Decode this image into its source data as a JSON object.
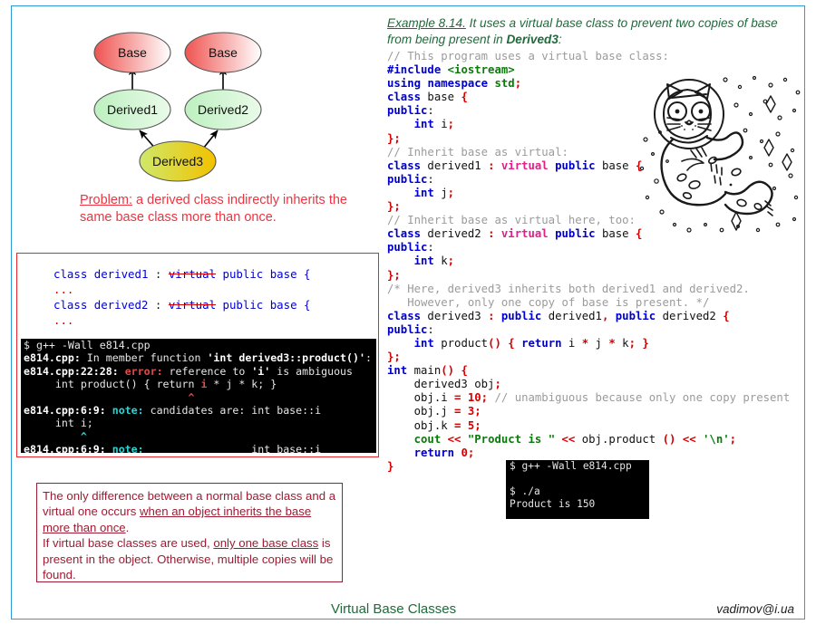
{
  "frame": {
    "border_color": "#2e9bd6"
  },
  "diagram": {
    "title": "virtual-base-class-inheritance-diagram",
    "nodes": [
      {
        "id": "base-left",
        "label": "Base",
        "fill_from": "#ef5350",
        "fill_to": "#ffffff"
      },
      {
        "id": "base-right",
        "label": "Base",
        "fill_from": "#ef5350",
        "fill_to": "#ffffff"
      },
      {
        "id": "derived1",
        "label": "Derived1",
        "fill_from": "#bdf0c0",
        "fill_to": "#e9fbe9"
      },
      {
        "id": "derived2",
        "label": "Derived2",
        "fill_from": "#bdf0c0",
        "fill_to": "#e9fbe9"
      },
      {
        "id": "derived3",
        "label": "Derived3",
        "fill_from": "#c9e56b",
        "fill_to": "#f0c400"
      }
    ],
    "edges": [
      {
        "from": "derived1",
        "to": "base-left"
      },
      {
        "from": "derived2",
        "to": "base-right"
      },
      {
        "from": "derived3",
        "to": "derived1"
      },
      {
        "from": "derived3",
        "to": "derived2"
      }
    ]
  },
  "problem": {
    "color": "#ef3340",
    "label": "Problem:",
    "text": " a derived class indirectly inherits the same base class more than once."
  },
  "snippet": {
    "border_color": "#e8252a",
    "lines": [
      [
        {
          "t": "class derived1 ",
          "c": "blue"
        },
        {
          "t": ": ",
          "c": "dark"
        },
        {
          "t": "virtual",
          "c": "strike"
        },
        {
          "t": " public base {",
          "c": "blue"
        }
      ],
      [
        {
          "t": "...",
          "c": "red"
        }
      ],
      [
        {
          "t": "class derived2 ",
          "c": "blue"
        },
        {
          "t": ": ",
          "c": "dark"
        },
        {
          "t": "virtual",
          "c": "strike"
        },
        {
          "t": " public base {",
          "c": "blue"
        }
      ],
      [
        {
          "t": "...",
          "c": "red"
        }
      ]
    ]
  },
  "terminal_left": {
    "background": "#000000",
    "lines": [
      [
        {
          "t": "$ ",
          "c": "white"
        },
        {
          "t": "g++ -Wall e814.cpp",
          "c": "white"
        }
      ],
      [
        {
          "t": "e814.cpp:",
          "c": "bold"
        },
        {
          "t": " In member function ",
          "c": "white"
        },
        {
          "t": "'int derived3::product()'",
          "c": "bold"
        },
        {
          "t": ":",
          "c": "white"
        }
      ],
      [
        {
          "t": "e814.cpp:22:28:",
          "c": "bold"
        },
        {
          "t": " ",
          "c": "white"
        },
        {
          "t": "error:",
          "c": "red"
        },
        {
          "t": " reference to ",
          "c": "white"
        },
        {
          "t": "'i'",
          "c": "bold"
        },
        {
          "t": " is ambiguous",
          "c": "white"
        }
      ],
      [
        {
          "t": "     int product() { return ",
          "c": "white"
        },
        {
          "t": "i",
          "c": "red"
        },
        {
          "t": " * j * k; }",
          "c": "white"
        }
      ],
      [
        {
          "t": "                          ",
          "c": "white"
        },
        {
          "t": "^",
          "c": "caretred"
        }
      ],
      [
        {
          "t": "e814.cpp:6:9:",
          "c": "bold"
        },
        {
          "t": " ",
          "c": "white"
        },
        {
          "t": "note:",
          "c": "cyan"
        },
        {
          "t": " candidates are: int base::i",
          "c": "white"
        }
      ],
      [
        {
          "t": "     int i;",
          "c": "white"
        }
      ],
      [
        {
          "t": "         ",
          "c": "white"
        },
        {
          "t": "^",
          "c": "caretcyan"
        }
      ],
      [
        {
          "t": "e814.cpp:6:9:",
          "c": "bold"
        },
        {
          "t": " ",
          "c": "white"
        },
        {
          "t": "note:",
          "c": "cyan"
        },
        {
          "t": "                 int base::i",
          "c": "white"
        }
      ]
    ]
  },
  "note": {
    "border_color": "#9e1b32",
    "color": "#9e1b32",
    "segments": [
      {
        "t": "The only difference between a normal base class and a virtual one occurs ",
        "u": false
      },
      {
        "t": "when an object inherits the base more than once",
        "u": true
      },
      {
        "t": ".",
        "u": false
      },
      {
        "t": "\nIf virtual base classes are used, ",
        "u": false
      },
      {
        "t": "only one base class",
        "u": true
      },
      {
        "t": " is present in the object. Otherwise, multiple copies will be found.",
        "u": false
      }
    ]
  },
  "example_head": {
    "color": "#1f6b3b",
    "lead": "Example 8.14.",
    "text_a": " It uses a virtual base class to prevent two copies of base from being present in ",
    "bold": "Derived3",
    "text_b": ":"
  },
  "main_code": {
    "lines": [
      [
        {
          "t": "// This program uses a virtual base class:",
          "c": "comment"
        }
      ],
      [
        {
          "t": "#include",
          "c": "pre"
        },
        {
          "t": " ",
          "c": "plain"
        },
        {
          "t": "<iostream>",
          "c": "inc"
        }
      ],
      [
        {
          "t": "using",
          "c": "kw"
        },
        {
          "t": " ",
          "c": "plain"
        },
        {
          "t": "namespace",
          "c": "kw"
        },
        {
          "t": " ",
          "c": "plain"
        },
        {
          "t": "std",
          "c": "inc"
        },
        {
          "t": ";",
          "c": "punc"
        }
      ],
      [
        {
          "t": "class",
          "c": "kw"
        },
        {
          "t": " base ",
          "c": "plain"
        },
        {
          "t": "{",
          "c": "punc"
        }
      ],
      [
        {
          "t": "public",
          "c": "kw"
        },
        {
          "t": ":",
          "c": "plain"
        }
      ],
      [
        {
          "t": "    ",
          "c": "plain"
        },
        {
          "t": "int",
          "c": "kw"
        },
        {
          "t": " i",
          "c": "plain"
        },
        {
          "t": ";",
          "c": "punc"
        }
      ],
      [
        {
          "t": "}",
          "c": "punc"
        },
        {
          "t": ";",
          "c": "punc"
        }
      ],
      [
        {
          "t": "// Inherit base as virtual:",
          "c": "comment"
        }
      ],
      [
        {
          "t": "class",
          "c": "kw"
        },
        {
          "t": " derived1 ",
          "c": "plain"
        },
        {
          "t": ":",
          "c": "punc"
        },
        {
          "t": " ",
          "c": "plain"
        },
        {
          "t": "virtual",
          "c": "virtual"
        },
        {
          "t": " ",
          "c": "plain"
        },
        {
          "t": "public",
          "c": "kw"
        },
        {
          "t": " base ",
          "c": "plain"
        },
        {
          "t": "{",
          "c": "punc"
        }
      ],
      [
        {
          "t": "public",
          "c": "kw"
        },
        {
          "t": ":",
          "c": "plain"
        }
      ],
      [
        {
          "t": "    ",
          "c": "plain"
        },
        {
          "t": "int",
          "c": "kw"
        },
        {
          "t": " j",
          "c": "plain"
        },
        {
          "t": ";",
          "c": "punc"
        }
      ],
      [
        {
          "t": "}",
          "c": "punc"
        },
        {
          "t": ";",
          "c": "punc"
        }
      ],
      [
        {
          "t": "// Inherit base as virtual here, too:",
          "c": "comment"
        }
      ],
      [
        {
          "t": "class",
          "c": "kw"
        },
        {
          "t": " derived2 ",
          "c": "plain"
        },
        {
          "t": ":",
          "c": "punc"
        },
        {
          "t": " ",
          "c": "plain"
        },
        {
          "t": "virtual",
          "c": "virtual"
        },
        {
          "t": " ",
          "c": "plain"
        },
        {
          "t": "public",
          "c": "kw"
        },
        {
          "t": " base ",
          "c": "plain"
        },
        {
          "t": "{",
          "c": "punc"
        }
      ],
      [
        {
          "t": "public",
          "c": "kw"
        },
        {
          "t": ":",
          "c": "plain"
        }
      ],
      [
        {
          "t": "    ",
          "c": "plain"
        },
        {
          "t": "int",
          "c": "kw"
        },
        {
          "t": " k",
          "c": "plain"
        },
        {
          "t": ";",
          "c": "punc"
        }
      ],
      [
        {
          "t": "}",
          "c": "punc"
        },
        {
          "t": ";",
          "c": "punc"
        }
      ],
      [
        {
          "t": "/* Here, derived3 inherits both derived1 and derived2.",
          "c": "comment"
        }
      ],
      [
        {
          "t": "   However, only one copy of base is present. */",
          "c": "comment"
        }
      ],
      [
        {
          "t": "class",
          "c": "kw"
        },
        {
          "t": " derived3 ",
          "c": "plain"
        },
        {
          "t": ":",
          "c": "punc"
        },
        {
          "t": " ",
          "c": "plain"
        },
        {
          "t": "public",
          "c": "kw"
        },
        {
          "t": " derived1",
          "c": "plain"
        },
        {
          "t": ",",
          "c": "punc"
        },
        {
          "t": " ",
          "c": "plain"
        },
        {
          "t": "public",
          "c": "kw"
        },
        {
          "t": " derived2 ",
          "c": "plain"
        },
        {
          "t": "{",
          "c": "punc"
        }
      ],
      [
        {
          "t": "public",
          "c": "kw"
        },
        {
          "t": ":",
          "c": "plain"
        }
      ],
      [
        {
          "t": "    ",
          "c": "plain"
        },
        {
          "t": "int",
          "c": "kw"
        },
        {
          "t": " product",
          "c": "plain"
        },
        {
          "t": "()",
          "c": "punc"
        },
        {
          "t": " ",
          "c": "plain"
        },
        {
          "t": "{",
          "c": "punc"
        },
        {
          "t": " ",
          "c": "plain"
        },
        {
          "t": "return",
          "c": "kw"
        },
        {
          "t": " i ",
          "c": "plain"
        },
        {
          "t": "*",
          "c": "punc"
        },
        {
          "t": " j ",
          "c": "plain"
        },
        {
          "t": "*",
          "c": "punc"
        },
        {
          "t": " k",
          "c": "plain"
        },
        {
          "t": ";",
          "c": "punc"
        },
        {
          "t": " ",
          "c": "plain"
        },
        {
          "t": "}",
          "c": "punc"
        }
      ],
      [
        {
          "t": "}",
          "c": "punc"
        },
        {
          "t": ";",
          "c": "punc"
        }
      ],
      [
        {
          "t": "int",
          "c": "kw"
        },
        {
          "t": " main",
          "c": "plain"
        },
        {
          "t": "()",
          "c": "punc"
        },
        {
          "t": " ",
          "c": "plain"
        },
        {
          "t": "{",
          "c": "punc"
        }
      ],
      [
        {
          "t": "    derived3 obj",
          "c": "plain"
        },
        {
          "t": ";",
          "c": "punc"
        }
      ],
      [
        {
          "t": "    obj.i ",
          "c": "plain"
        },
        {
          "t": "=",
          "c": "punc"
        },
        {
          "t": " ",
          "c": "plain"
        },
        {
          "t": "10",
          "c": "num"
        },
        {
          "t": ";",
          "c": "punc"
        },
        {
          "t": " ",
          "c": "plain"
        },
        {
          "t": "// unambiguous because only one copy present",
          "c": "comment"
        }
      ],
      [
        {
          "t": "    obj.j ",
          "c": "plain"
        },
        {
          "t": "=",
          "c": "punc"
        },
        {
          "t": " ",
          "c": "plain"
        },
        {
          "t": "3",
          "c": "num"
        },
        {
          "t": ";",
          "c": "punc"
        }
      ],
      [
        {
          "t": "    obj.k ",
          "c": "plain"
        },
        {
          "t": "=",
          "c": "punc"
        },
        {
          "t": " ",
          "c": "plain"
        },
        {
          "t": "5",
          "c": "num"
        },
        {
          "t": ";",
          "c": "punc"
        }
      ],
      [
        {
          "t": "    ",
          "c": "plain"
        },
        {
          "t": "cout",
          "c": "inc"
        },
        {
          "t": " ",
          "c": "plain"
        },
        {
          "t": "<<",
          "c": "punc"
        },
        {
          "t": " ",
          "c": "plain"
        },
        {
          "t": "\"Product is \"",
          "c": "str"
        },
        {
          "t": " ",
          "c": "plain"
        },
        {
          "t": "<<",
          "c": "punc"
        },
        {
          "t": " obj.product ",
          "c": "plain"
        },
        {
          "t": "()",
          "c": "punc"
        },
        {
          "t": " ",
          "c": "plain"
        },
        {
          "t": "<<",
          "c": "punc"
        },
        {
          "t": " ",
          "c": "plain"
        },
        {
          "t": "'\\n'",
          "c": "str"
        },
        {
          "t": ";",
          "c": "punc"
        }
      ],
      [
        {
          "t": "    ",
          "c": "plain"
        },
        {
          "t": "return",
          "c": "kw"
        },
        {
          "t": " ",
          "c": "plain"
        },
        {
          "t": "0",
          "c": "num"
        },
        {
          "t": ";",
          "c": "punc"
        }
      ],
      [
        {
          "t": "}",
          "c": "punc"
        }
      ]
    ]
  },
  "terminal_right": {
    "background": "#000000",
    "lines": [
      "$ g++ -Wall e814.cpp",
      "",
      "$ ./a",
      "Product is 150"
    ]
  },
  "illustration": {
    "name": "astronaut-cat-doodle"
  },
  "footer": {
    "title": "Virtual Base Classes",
    "email": "vadimov@i.ua"
  }
}
